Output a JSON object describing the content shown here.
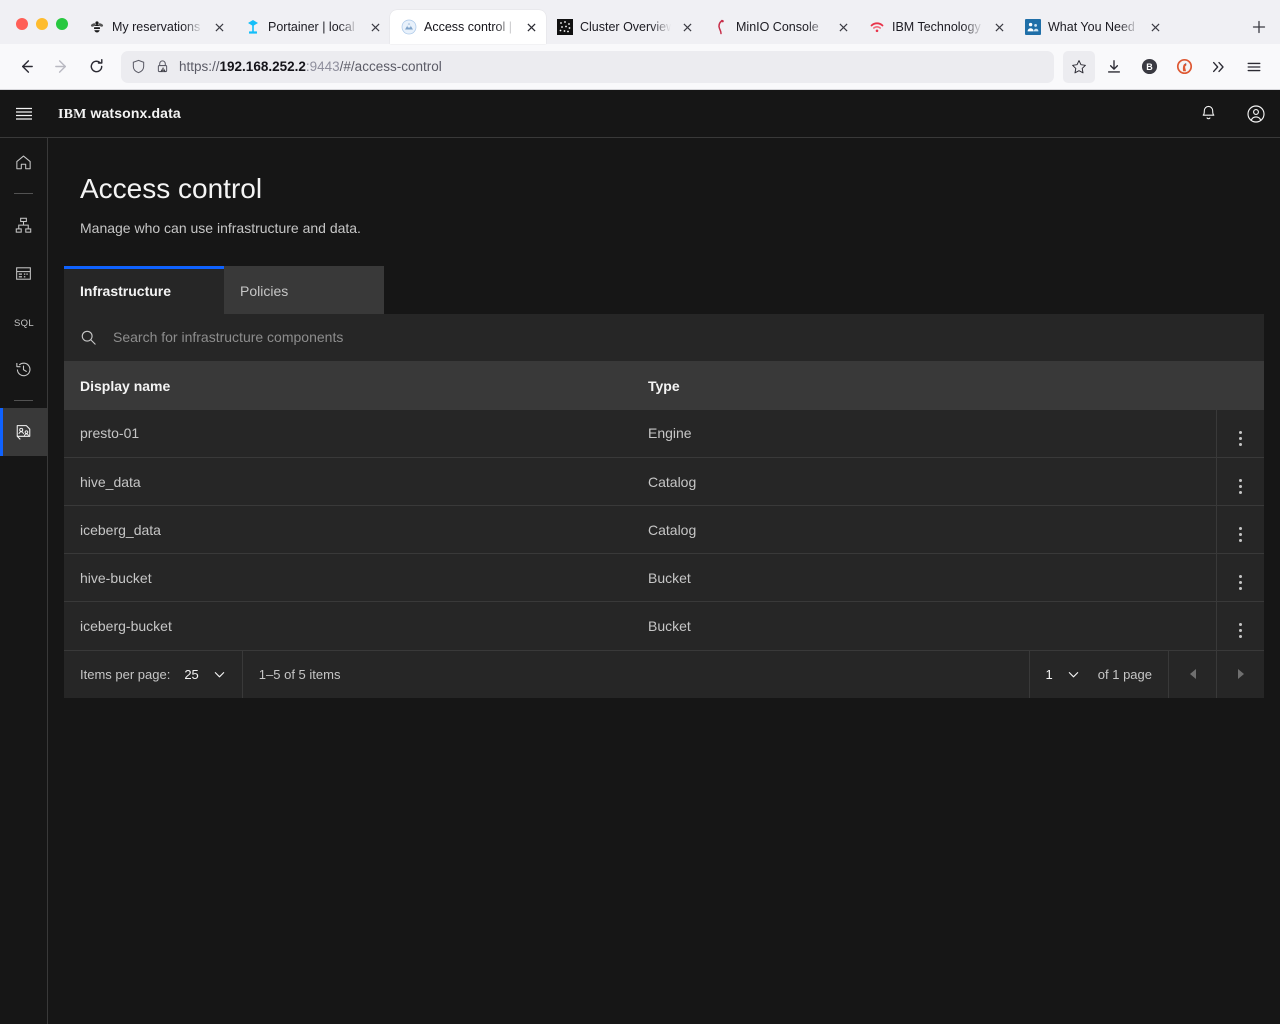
{
  "browser": {
    "window_controls": [
      "close",
      "minimize",
      "maximize"
    ],
    "tabs": [
      {
        "title": "My reservations",
        "favicon": "bee-icon",
        "active": false
      },
      {
        "title": "Portainer | local",
        "favicon": "portainer-icon",
        "active": false
      },
      {
        "title": "Access control | IBM",
        "favicon": "watsonx-icon",
        "active": true
      },
      {
        "title": "Cluster Overview -",
        "favicon": "kubernetes-dots-icon",
        "active": false
      },
      {
        "title": "MinIO Console",
        "favicon": "minio-icon",
        "active": false
      },
      {
        "title": "IBM Technology Zo",
        "favicon": "wifi-icon",
        "active": false
      },
      {
        "title": "What You Need To",
        "favicon": "people-icon",
        "active": false
      }
    ],
    "new_tab_label": "+",
    "toolbar": {
      "back": "back-arrow",
      "forward": "forward-arrow",
      "reload": "reload",
      "shield": "shield-icon",
      "lock": "lock-warning-icon",
      "url_scheme": "https://",
      "url_host": "192.168.252.2",
      "url_port": ":9443",
      "url_path": "/#/access-control",
      "bookmark": "star-icon",
      "downloads": "download-icon",
      "bitwarden": "B",
      "duckduckgo": "duckduckgo-icon",
      "overflow": "»",
      "menu": "hamburger-icon"
    }
  },
  "app": {
    "header": {
      "menu_icon": "hamburger-icon",
      "brand_prefix": "IBM",
      "brand_name": "watsonx.data",
      "notifications_icon": "bell-icon",
      "account_icon": "user-avatar-icon"
    },
    "rail": [
      {
        "name": "home",
        "icon": "home-icon",
        "active": false
      },
      {
        "name": "divider",
        "icon": "divider",
        "active": false
      },
      {
        "name": "infrastructure-manager",
        "icon": "hierarchy-icon",
        "active": false
      },
      {
        "name": "data-manager",
        "icon": "data-table-icon",
        "active": false
      },
      {
        "name": "query-workspace",
        "icon": "sql-icon",
        "active": false
      },
      {
        "name": "query-history",
        "icon": "history-icon",
        "active": false
      },
      {
        "name": "divider",
        "icon": "divider",
        "active": false
      },
      {
        "name": "access-control",
        "icon": "access-control-icon",
        "active": true
      }
    ],
    "page": {
      "title": "Access control",
      "subtitle": "Manage who can use infrastructure and data."
    },
    "tabs": [
      {
        "label": "Infrastructure",
        "selected": true
      },
      {
        "label": "Policies",
        "selected": false
      }
    ],
    "search": {
      "icon": "search-icon",
      "value": "",
      "placeholder": "Search for infrastructure components"
    },
    "table": {
      "columns": [
        "Display name",
        "Type",
        ""
      ],
      "rows": [
        {
          "display_name": "presto-01",
          "type": "Engine",
          "menu": "overflow-menu-icon"
        },
        {
          "display_name": "hive_data",
          "type": "Catalog",
          "menu": "overflow-menu-icon"
        },
        {
          "display_name": "iceberg_data",
          "type": "Catalog",
          "menu": "overflow-menu-icon"
        },
        {
          "display_name": "hive-bucket",
          "type": "Bucket",
          "menu": "overflow-menu-icon"
        },
        {
          "display_name": "iceberg-bucket",
          "type": "Bucket",
          "menu": "overflow-menu-icon"
        }
      ]
    },
    "pagination": {
      "items_per_page_label": "Items per page:",
      "items_per_page_value": "25",
      "range_text": "1–5 of 5 items",
      "page_value": "1",
      "page_total_text": "of 1 page",
      "prev_icon": "caret-left-icon",
      "next_icon": "caret-right-icon"
    }
  },
  "colors": {
    "accent_blue": "#0f62fe",
    "page_bg": "#161616",
    "surface": "#262626",
    "surface_alt": "#393939",
    "text_primary": "#f4f4f4",
    "text_secondary": "#c6c6c6",
    "text_placeholder": "#8d8d8d"
  }
}
